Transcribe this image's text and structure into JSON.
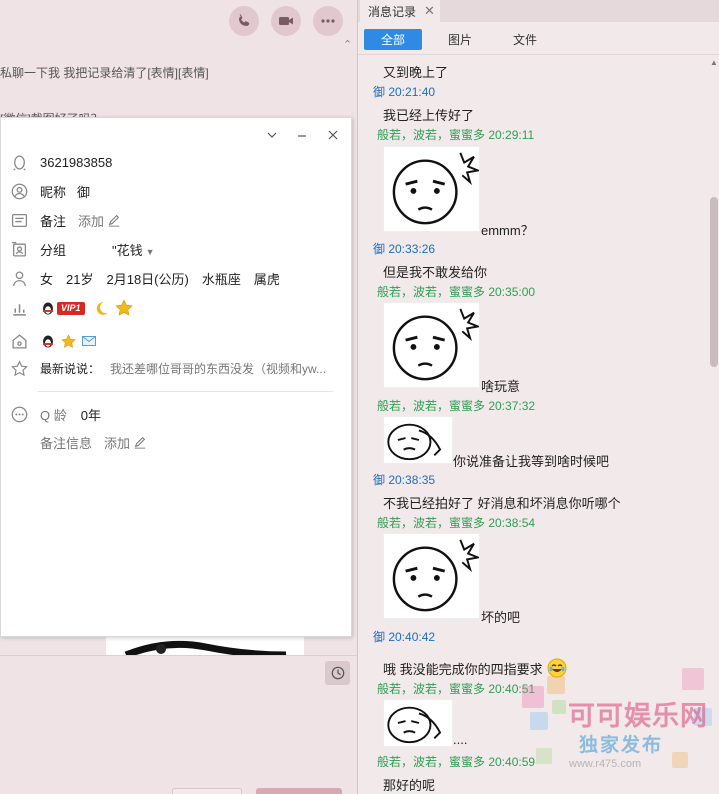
{
  "chat": {
    "line1": "私聊一下我 我把记录给清了[表情][表情]",
    "line2": "[微信]截图好了吗？"
  },
  "profile": {
    "qq_number": "3621983858",
    "nickname_label": "昵称",
    "nickname_value": "御",
    "remark_label": "备注",
    "remark_action": "添加",
    "group_label": "分组",
    "group_value": "\"花钱",
    "gender": "女",
    "age": "21岁",
    "birthday": "2月18日(公历)",
    "zodiac": "水瓶座",
    "chinese_zodiac": "属虎",
    "vip_label": "VIP1",
    "latest_label": "最新说说：",
    "latest_text": "我还差哪位哥哥的东西没发（视频和yw...",
    "qage_label": "Q 龄",
    "qage_value": "0年",
    "remark_info_label": "备注信息",
    "remark_info_action": "添加"
  },
  "history": {
    "tab_title": "消息记录",
    "filters": {
      "all": "全部",
      "images": "图片",
      "files": "文件"
    },
    "messages": {
      "m0": "又到晚上了",
      "h1": "御 20:21:40",
      "m1": "我已经上传好了",
      "h2": "般若，波若，蜜蜜多 20:29:11",
      "c2": "emmm？",
      "h3": "御 20:33:26",
      "m3": "但是我不敢发给你",
      "h4": "般若，波若，蜜蜜多 20:35:00",
      "c4": "啥玩意",
      "h5": "般若，波若，蜜蜜多 20:37:32",
      "c5": "你说准备让我等到啥时候吧",
      "h6": "御 20:38:35",
      "m6": "不我已经拍好了 好消息和坏消息你听哪个",
      "h7": "般若，波若，蜜蜜多 20:38:54",
      "c7": "坏的吧",
      "h8": "御 20:40:42",
      "m8": "哦 我没能完成你的四指要求",
      "h9": "般若，波若，蜜蜜多 20:40:51",
      "c9": "....",
      "h10": "般若，波若，蜜蜜多 20:40:59",
      "m10": "那好的呢"
    }
  },
  "watermark": {
    "title": "可可娱乐网",
    "subtitle": "独家发布",
    "url": "www.r475.com"
  },
  "colors": {
    "accent": "#2f8ae3",
    "me": "#1d6ebd",
    "them": "#2d9f53",
    "background": "#efe3e6"
  }
}
